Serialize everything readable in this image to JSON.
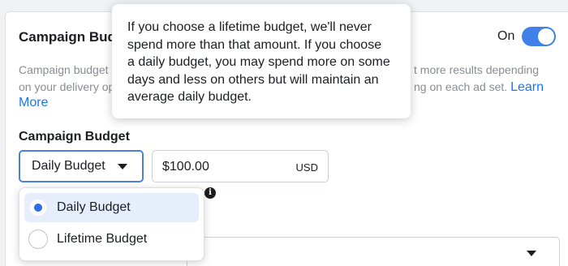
{
  "section": {
    "title": "Campaign Budg",
    "toggle_label": "On",
    "toggle_on": true,
    "description": {
      "line1_left": "Campaign budget o",
      "line1_right": "t more results depending",
      "line2_left": "on your delivery op",
      "line2_right": "ng on each ad set.",
      "learn_more_part1": "Learn",
      "learn_more_part2": "More"
    }
  },
  "budget": {
    "label": "Campaign Budget",
    "type_selected": "Daily Budget",
    "amount": "$100.00",
    "currency": "USD",
    "info_icon": "info-icon"
  },
  "dropdown": {
    "options": [
      {
        "label": "Daily Budget",
        "selected": true
      },
      {
        "label": "Lifetime Budget",
        "selected": false
      }
    ]
  },
  "tooltip": {
    "lines": [
      "If you choose a lifetime budget, we'll never",
      "spend more than that amount. If you choose",
      "a daily budget, you may spend more on some",
      "days and less on others but will maintain an",
      "average daily budget."
    ]
  },
  "colors": {
    "accent": "#1877f2",
    "toggle": "#4080e8",
    "selected_option_bg": "#e7eefb",
    "radio_dot": "#2d6ee8"
  }
}
